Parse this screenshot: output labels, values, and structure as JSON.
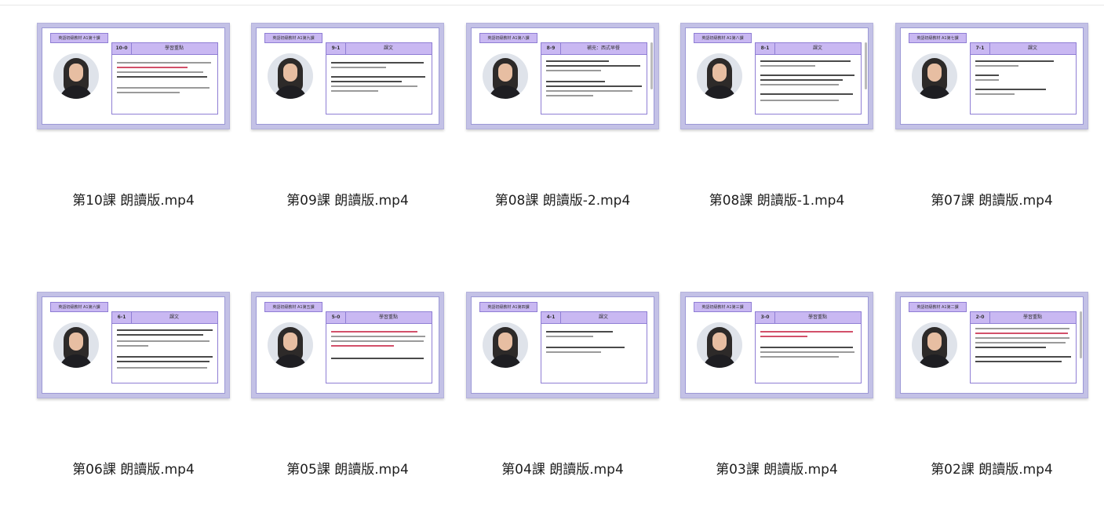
{
  "files": [
    {
      "name": "第10課 朗讀版.mp4",
      "series": "英語初級教材 A1第十課",
      "code": "10-0",
      "title": "學習重點"
    },
    {
      "name": "第09課 朗讀版.mp4",
      "series": "英語初級教材 A1第九課",
      "code": "9-1",
      "title": "課文"
    },
    {
      "name": "第08課 朗讀版-2.mp4",
      "series": "英語初級教材 A1第八課",
      "code": "8-9",
      "title": "補充：西式早餐"
    },
    {
      "name": "第08課 朗讀版-1.mp4",
      "series": "英語初級教材 A1第八課",
      "code": "8-1",
      "title": "課文"
    },
    {
      "name": "第07課 朗讀版.mp4",
      "series": "英語初級教材 A1第七課",
      "code": "7-1",
      "title": "課文"
    },
    {
      "name": "第06課 朗讀版.mp4",
      "series": "英語初級教材 A1第六課",
      "code": "6-1",
      "title": "課文"
    },
    {
      "name": "第05課 朗讀版.mp4",
      "series": "英語初級教材 A1第五課",
      "code": "5-0",
      "title": "學習重點"
    },
    {
      "name": "第04課 朗讀版.mp4",
      "series": "英語初級教材 A1第四課",
      "code": "4-1",
      "title": "課文"
    },
    {
      "name": "第03課 朗讀版.mp4",
      "series": "英語初級教材 A1第三課",
      "code": "3-0",
      "title": "學習重點"
    },
    {
      "name": "第02課 朗讀版.mp4",
      "series": "英語初級教材 A1第二課",
      "code": "2-0",
      "title": "學習重點"
    }
  ]
}
